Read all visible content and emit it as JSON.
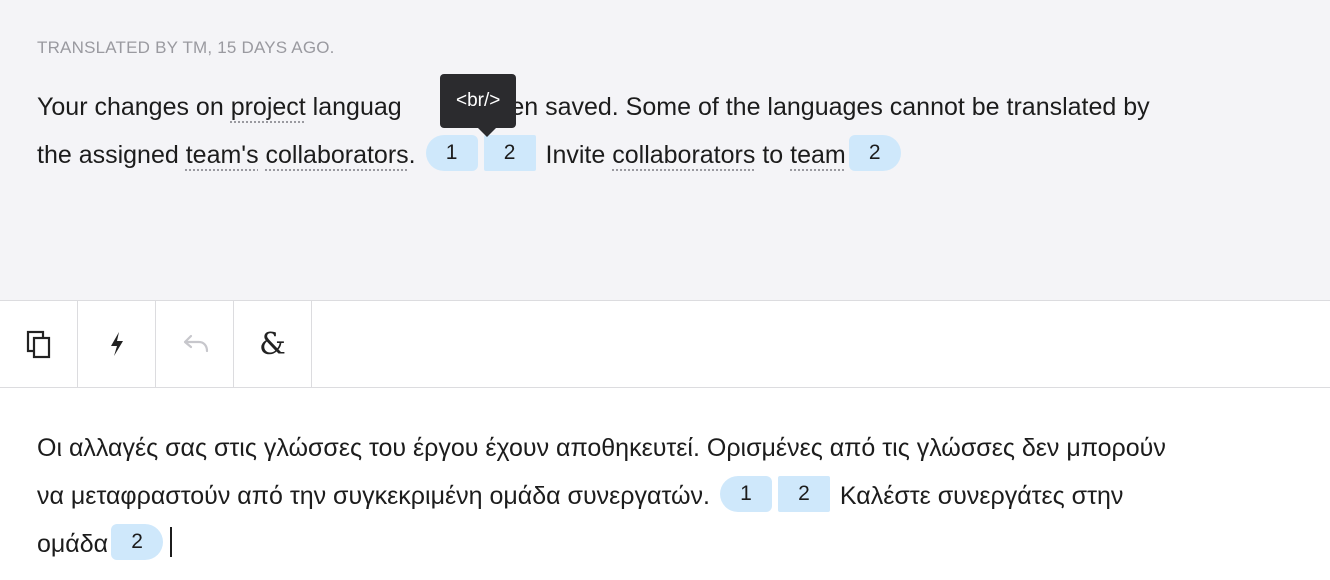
{
  "source": {
    "meta": "TRANSLATED BY TM, 15 DAYS AGO.",
    "tooltip": "<br/>",
    "line1": {
      "t1": "Your changes on ",
      "term_project": "project",
      "t2": " languag",
      "t3": "e been saved. Some of the languages cannot be translated by"
    },
    "line2": {
      "t1": "the assigned ",
      "term_teams": "team's",
      "sp": " ",
      "term_collaborators": "collaborators",
      "dot": ".",
      "tag1": "1",
      "tag2": "2",
      "t2": "Invite ",
      "term_collaborators2": "collaborators",
      "t3": " to ",
      "term_team": "team",
      "tag3": "2"
    }
  },
  "toolbar": {
    "icons": [
      "copy-icon",
      "lightning-icon",
      "undo-icon",
      "ampersand-icon"
    ],
    "ampersand": "&"
  },
  "target": {
    "line1": "Οι αλλαγές σας στις γλώσσες του έργου έχουν αποθηκευτεί. Ορισμένες από τις γλώσσες δεν μπορούν",
    "line2_text": "να μεταφραστούν από την συγκεκριμένη ομάδα συνεργατών.",
    "tag1": "1",
    "tag2": "2",
    "line2_rest": "Καλέστε συνεργάτες στην",
    "line3_text": "ομάδα",
    "tag3": "2"
  }
}
